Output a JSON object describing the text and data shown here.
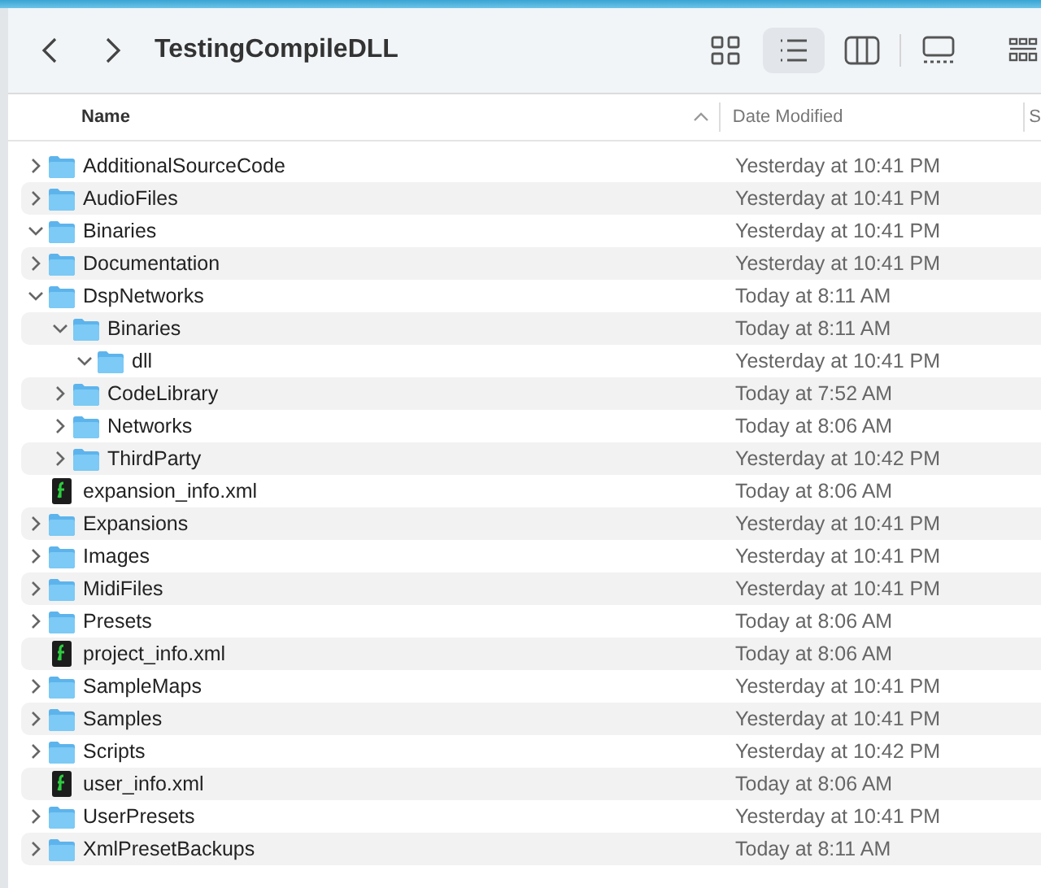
{
  "window": {
    "title": "TestingCompileDLL"
  },
  "toolbar": {
    "views": [
      {
        "kind": "icons",
        "selected": false
      },
      {
        "kind": "list",
        "selected": true
      },
      {
        "kind": "columns",
        "selected": false
      },
      {
        "kind": "gallery",
        "selected": false
      }
    ]
  },
  "table": {
    "columns": [
      {
        "label": "Name",
        "sorted": true
      },
      {
        "label": "Date Modified",
        "sorted": false
      },
      {
        "label": "S",
        "sorted": false
      }
    ],
    "rows": [
      {
        "name": "AdditionalSourceCode",
        "kind": "folder",
        "expanded": false,
        "date": "Yesterday at 10:41 PM"
      },
      {
        "name": "AudioFiles",
        "kind": "folder",
        "expanded": false,
        "date": "Yesterday at 10:41 PM"
      },
      {
        "name": "Binaries",
        "kind": "folder",
        "expanded": true,
        "date": "Yesterday at 10:41 PM"
      },
      {
        "name": "Documentation",
        "kind": "folder",
        "expanded": false,
        "date": "Yesterday at 10:41 PM"
      },
      {
        "name": "DspNetworks",
        "kind": "folder",
        "expanded": true,
        "date": "Today at 8:11 AM",
        "children": [
          {
            "name": "Binaries",
            "kind": "folder",
            "expanded": true,
            "date": "Today at 8:11 AM",
            "children": [
              {
                "name": "dll",
                "kind": "folder",
                "expanded": true,
                "date": "Yesterday at 10:41 PM"
              }
            ]
          },
          {
            "name": "CodeLibrary",
            "kind": "folder",
            "expanded": false,
            "date": "Today at 7:52 AM"
          },
          {
            "name": "Networks",
            "kind": "folder",
            "expanded": false,
            "date": "Today at 8:06 AM"
          },
          {
            "name": "ThirdParty",
            "kind": "folder",
            "expanded": false,
            "date": "Yesterday at 10:42 PM"
          }
        ]
      },
      {
        "name": "expansion_info.xml",
        "kind": "file",
        "date": "Today at 8:06 AM"
      },
      {
        "name": "Expansions",
        "kind": "folder",
        "expanded": false,
        "date": "Yesterday at 10:41 PM"
      },
      {
        "name": "Images",
        "kind": "folder",
        "expanded": false,
        "date": "Yesterday at 10:41 PM"
      },
      {
        "name": "MidiFiles",
        "kind": "folder",
        "expanded": false,
        "date": "Yesterday at 10:41 PM"
      },
      {
        "name": "Presets",
        "kind": "folder",
        "expanded": false,
        "date": "Today at 8:06 AM"
      },
      {
        "name": "project_info.xml",
        "kind": "file",
        "date": "Today at 8:06 AM"
      },
      {
        "name": "SampleMaps",
        "kind": "folder",
        "expanded": false,
        "date": "Yesterday at 10:41 PM"
      },
      {
        "name": "Samples",
        "kind": "folder",
        "expanded": false,
        "date": "Yesterday at 10:41 PM"
      },
      {
        "name": "Scripts",
        "kind": "folder",
        "expanded": false,
        "date": "Yesterday at 10:42 PM"
      },
      {
        "name": "user_info.xml",
        "kind": "file",
        "date": "Today at 8:06 AM"
      },
      {
        "name": "UserPresets",
        "kind": "folder",
        "expanded": false,
        "date": "Yesterday at 10:41 PM"
      },
      {
        "name": "XmlPresetBackups",
        "kind": "folder",
        "expanded": false,
        "date": "Today at 8:11 AM"
      }
    ]
  }
}
